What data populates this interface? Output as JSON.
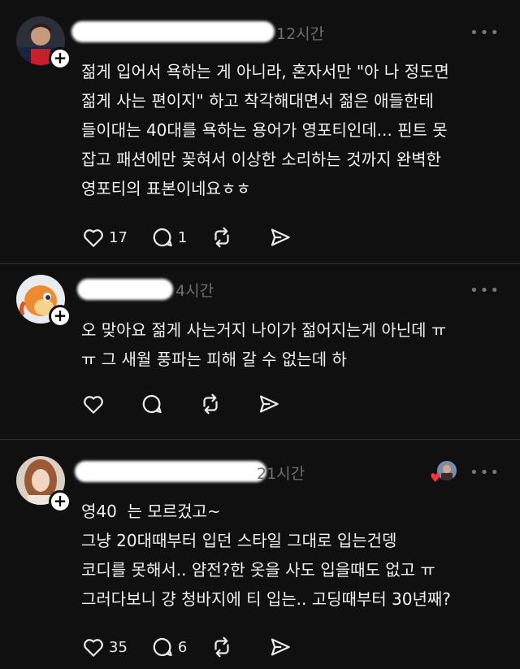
{
  "posts": [
    {
      "time": "12시간",
      "text": "젊게 입어서 욕하는 게 아니라, 혼자서만 \"아 나 정도면\n젊게 사는 편이지\" 하고 착각해대면서 젊은 애들한테\n들이대는 40대를 욕하는 용어가 영포티인데... 핀트 못\n잡고 패션에만 꽂혀서 이상한 소리하는 것까지 완벽한\n영포티의 표본이네요ㅎㅎ",
      "likes": "17",
      "replies": "1",
      "reposts": "",
      "more": "•••"
    },
    {
      "time": "4시간",
      "text": "오 맞아요 젊게 사는거지 나이가 젊어지는게 아닌데 ㅠ\nㅠ 그 새월 풍파는 피해 갈 수 없는데 하",
      "likes": "",
      "replies": "",
      "reposts": "",
      "more": "•••"
    },
    {
      "time": "21시간",
      "text": "영40  는 모르겄고~\n그냥 20대때부터 입던 스타일 그대로 입는건뎅\n코디를 못해서.. 얌전?한 옷을 사도 입을때도 없고 ㅠ\n그러다보니 걍 청바지에 티 입는.. 고딩때부터 30년째?",
      "likes": "35",
      "replies": "6",
      "reposts": "",
      "more": "•••"
    }
  ],
  "icons": {
    "follow": "+",
    "like": "heart-icon",
    "reply": "comment-icon",
    "repost": "repost-icon",
    "share": "send-icon",
    "liked_by": "♥"
  },
  "colors": {
    "background": "#101010",
    "text": "#f1f1f1",
    "muted": "#6f6f6f",
    "liked": "#ff3040"
  }
}
